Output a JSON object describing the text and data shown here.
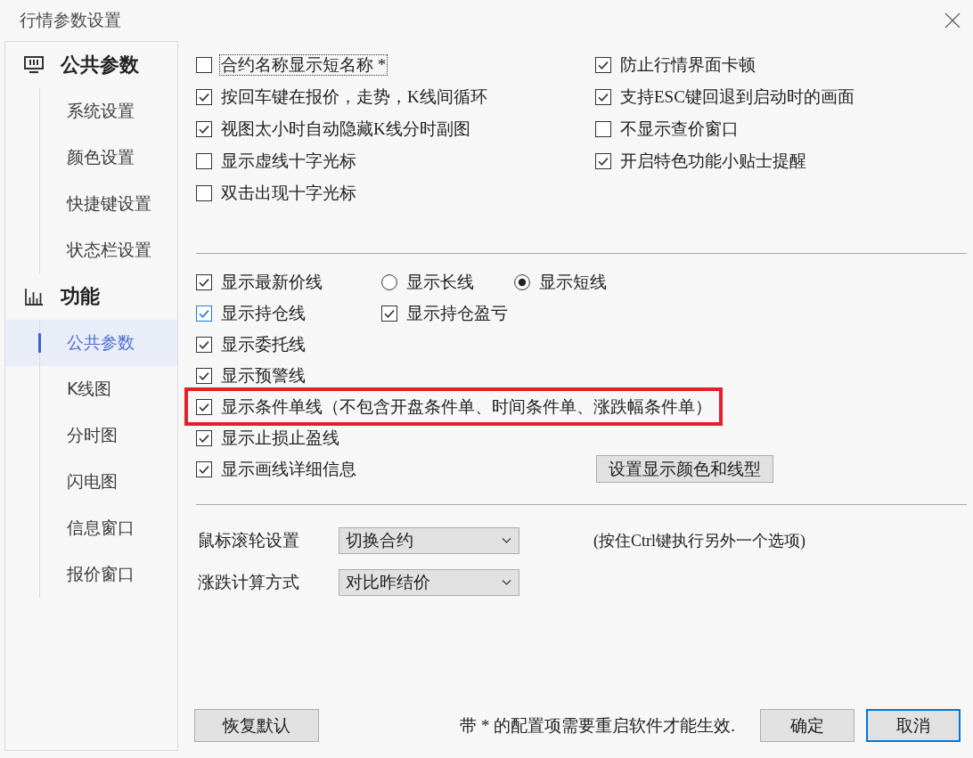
{
  "window": {
    "title": "行情参数设置"
  },
  "sidebar": {
    "groups": [
      {
        "title": "公共参数",
        "kind": "monitor",
        "items": [
          {
            "label": "系统设置",
            "selected": false
          },
          {
            "label": "颜色设置",
            "selected": false
          },
          {
            "label": "快捷键设置",
            "selected": false
          },
          {
            "label": "状态栏设置",
            "selected": false
          }
        ]
      },
      {
        "title": "功能",
        "kind": "chart",
        "items": [
          {
            "label": "公共参数",
            "selected": true
          },
          {
            "label": "K线图",
            "selected": false
          },
          {
            "label": "分时图",
            "selected": false
          },
          {
            "label": "闪电图",
            "selected": false
          },
          {
            "label": "信息窗口",
            "selected": false
          },
          {
            "label": "报价窗口",
            "selected": false
          }
        ]
      }
    ]
  },
  "top_options": {
    "left": [
      {
        "label": "合约名称显示短名称 *",
        "checked": false,
        "focused": true
      },
      {
        "label": "按回车键在报价，走势，K线间循环",
        "checked": true,
        "focused": false
      },
      {
        "label": "视图太小时自动隐藏K线分时副图",
        "checked": true,
        "focused": false
      },
      {
        "label": "显示虚线十字光标",
        "checked": false,
        "focused": false
      },
      {
        "label": "双击出现十字光标",
        "checked": false,
        "focused": false
      }
    ],
    "right": [
      {
        "label": "防止行情界面卡顿",
        "checked": true,
        "focused": false
      },
      {
        "label": "支持ESC键回退到启动时的画面",
        "checked": true,
        "focused": false
      },
      {
        "label": "不显示查价窗口",
        "checked": false,
        "focused": false
      },
      {
        "label": "开启特色功能小贴士提醒",
        "checked": true,
        "focused": false
      }
    ]
  },
  "line_options": [
    {
      "highlighted": false,
      "controls": [
        {
          "kind": "checkbox",
          "label": "显示最新价线",
          "checked": true,
          "hovered": false
        },
        {
          "kind": "radio",
          "label": "显示长线",
          "selected": false,
          "hovered": false
        },
        {
          "kind": "radio",
          "label": "显示短线",
          "selected": true,
          "hovered": false
        }
      ]
    },
    {
      "highlighted": false,
      "controls": [
        {
          "kind": "checkbox",
          "label": "显示持仓线",
          "checked": true,
          "hovered": true
        },
        {
          "kind": "checkbox",
          "label": "显示持仓盈亏",
          "checked": true,
          "hovered": false
        }
      ]
    },
    {
      "highlighted": false,
      "controls": [
        {
          "kind": "checkbox",
          "label": "显示委托线",
          "checked": true,
          "hovered": false
        }
      ]
    },
    {
      "highlighted": false,
      "controls": [
        {
          "kind": "checkbox",
          "label": "显示预警线",
          "checked": true,
          "hovered": false
        }
      ]
    },
    {
      "highlighted": true,
      "controls": [
        {
          "kind": "checkbox",
          "label": "显示条件单线（不包含开盘条件单、时间条件单、涨跌幅条件单）",
          "checked": true,
          "hovered": false
        }
      ]
    },
    {
      "highlighted": false,
      "controls": [
        {
          "kind": "checkbox",
          "label": "显示止损止盈线",
          "checked": true,
          "hovered": false
        }
      ]
    },
    {
      "highlighted": false,
      "controls": [
        {
          "kind": "checkbox",
          "label": "显示画线详细信息",
          "checked": true,
          "hovered": false
        },
        {
          "kind": "button",
          "label": "设置显示颜色和线型"
        }
      ]
    }
  ],
  "settings": [
    {
      "label": "鼠标滚轮设置",
      "value": "切换合约",
      "note": "(按住Ctrl键执行另外一个选项)"
    },
    {
      "label": "涨跌计算方式",
      "value": "对比昨结价"
    }
  ],
  "footer": {
    "reset_button": "恢复默认",
    "note": "带 * 的配置项需要重启软件才能生效.",
    "buttons": [
      {
        "label": "确定",
        "focused": false
      },
      {
        "label": "取消",
        "focused": true
      }
    ]
  }
}
